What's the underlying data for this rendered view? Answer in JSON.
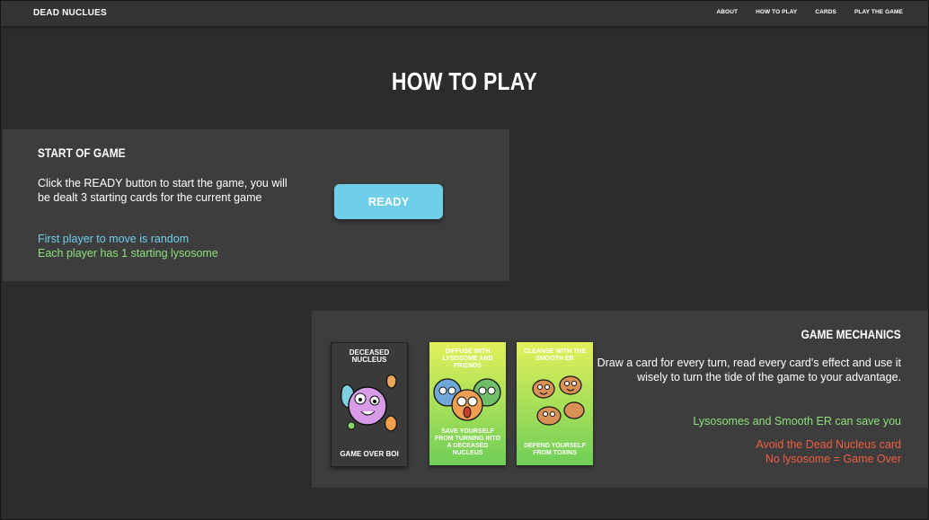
{
  "nav": {
    "brand": "DEAD NUCLUES",
    "links": [
      "ABOUT",
      "HOW TO PLAY",
      "CARDS",
      "PLAY THE GAME"
    ]
  },
  "page_title": "HOW TO PLAY",
  "start": {
    "title": "START OF GAME",
    "description": "Click the READY button to start the game, you will be dealt 3 starting cards for the current game",
    "note_blue": "First player to move is random",
    "note_green": "Each player has 1 starting lysosome",
    "ready_label": "READY"
  },
  "mechanics": {
    "title": "GAME MECHANICS",
    "description": "Draw a card for every turn, read every card's effect and use it wisely to turn the tide of the game to your advantage.",
    "note_green": "Lysosomes and Smooth ER can save you",
    "note_red_1": "Avoid the Dead Nucleus card",
    "note_red_2": "No lysosome = Game Over"
  },
  "cards": [
    {
      "top": "DECEASED NUCLEUS",
      "bottom": "GAME OVER BOI"
    },
    {
      "top": "DIFFUSE WITH LYSOSOME AND FRIENDS",
      "bottom": "SAVE YOURSELF FROM TURNING INTO A DECEASED NUCLEUS"
    },
    {
      "top": "CLEANSE WITH THE SMOOTH ER",
      "bottom": "DEFEND YOURSELF FROM TOXINS"
    }
  ],
  "colors": {
    "accent_blue": "#6fcfe9",
    "green": "#8de07a",
    "red": "#f05d3f",
    "panel": "#3d3d3d",
    "background": "#2c2c2c"
  }
}
